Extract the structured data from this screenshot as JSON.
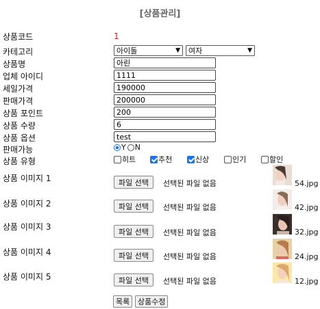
{
  "page_title": "[상품관리]",
  "labels": {
    "code": "상품코드",
    "category": "카테고리",
    "name": "상품명",
    "vendor": "업체 아이디",
    "cost": "세일가격",
    "price": "판매가격",
    "point": "상품 포인트",
    "qty": "상품 수량",
    "option": "상품 옵션",
    "sale": "판매가능",
    "type": "상품 유형"
  },
  "values": {
    "code": "1",
    "category1": "아이돌",
    "category2": "여자",
    "name": "아린",
    "vendor": "1111",
    "cost": "190000",
    "price": "200000",
    "point": "200",
    "qty": "6",
    "option": "test"
  },
  "sale_options": [
    {
      "label": "Y",
      "checked": true
    },
    {
      "label": "N",
      "checked": false
    }
  ],
  "types": [
    {
      "label": "히트",
      "checked": false
    },
    {
      "label": "추천",
      "checked": true
    },
    {
      "label": "신상",
      "checked": true
    },
    {
      "label": "인기",
      "checked": false
    },
    {
      "label": "할인",
      "checked": false
    }
  ],
  "images": [
    {
      "label": "상품 이미지 1",
      "button": "파일 선택",
      "note": "선택된 파일 없음",
      "file": "54.jpg"
    },
    {
      "label": "상품 이미지 2",
      "button": "파일 선택",
      "note": "선택된 파일 없음",
      "file": "42.jpg"
    },
    {
      "label": "상품 이미지 3",
      "button": "파일 선택",
      "note": "선택된 파일 없음",
      "file": "32.jpg"
    },
    {
      "label": "상품 이미지 4",
      "button": "파일 선택",
      "note": "선택된 파일 없음",
      "file": "24.jpg"
    },
    {
      "label": "상품 이미지 5",
      "button": "파일 선택",
      "note": "선택된 파일 없음",
      "file": "12.jpg"
    }
  ],
  "buttons": {
    "list": "목록",
    "edit": "상품수정"
  },
  "colors": {
    "title": "#666666",
    "code": "#c02020",
    "accent": "#1a73e8"
  },
  "icons": {
    "dropdown": "chevron-down-icon",
    "radio": "radio-icon",
    "checkbox": "checkbox-icon"
  }
}
